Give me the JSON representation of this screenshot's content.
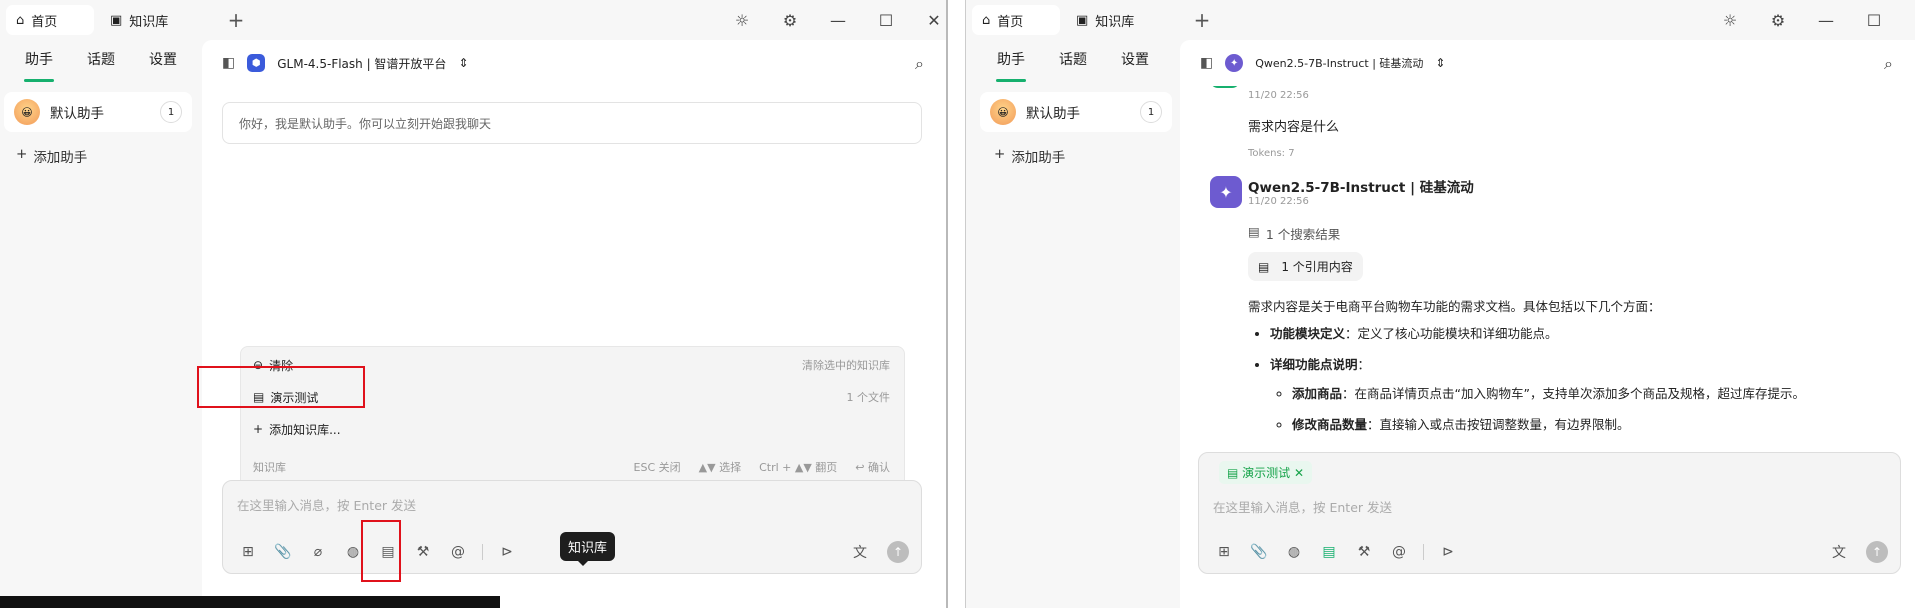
{
  "left": {
    "tabs": {
      "home": "首页",
      "kb": "知识库"
    },
    "sidebar": {
      "tabs": [
        "助手",
        "话题",
        "设置"
      ],
      "assistant": {
        "name": "默认助手",
        "count": "1"
      },
      "add_assistant": "添加助手"
    },
    "model": "GLM-4.5-Flash | 智谱开放平台",
    "greeting": "你好，我是默认助手。你可以立刻开始跟我聊天",
    "kb_popup": {
      "clear_label": "清除",
      "clear_hint": "清除选中的知识库",
      "item_label": "演示测试",
      "item_hint": "1 个文件",
      "add_label": "添加知识库...",
      "footer_title": "知识库",
      "esc": "ESC 关闭",
      "select": "▲▼ 选择",
      "page": "Ctrl + ▲▼ 翻页",
      "confirm": "↩ 确认"
    },
    "input_placeholder": "在这里输入消息，按 Enter 发送",
    "tooltip": "知识库"
  },
  "right": {
    "tabs": {
      "home": "首页",
      "kb": "知识库"
    },
    "sidebar": {
      "tabs": [
        "助手",
        "话题",
        "设置"
      ],
      "assistant": {
        "name": "默认助手",
        "count": "1"
      },
      "add_assistant": "添加助手"
    },
    "model": "Qwen2.5-7B-Instruct | 硅基流动",
    "chat": {
      "user_time": "11/20 22:56",
      "user_text": "需求内容是什么",
      "tokens": "Tokens: 7",
      "bot_name": "Qwen2.5-7B-Instruct | 硅基流动",
      "bot_time": "11/20 22:56",
      "search_results": "1 个搜索结果",
      "quote": "1 个引用内容",
      "intro": "需求内容是关于电商平台购物车功能的需求文档。具体包括以下几个方面：",
      "b1_title": "功能模块定义",
      "b1_text": "：定义了核心功能模块和详细功能点。",
      "b2_title": "详细功能点说明",
      "b2_text": "：",
      "s1_title": "添加商品",
      "s1_text": "：在商品详情页点击“加入购物车”，支持单次添加多个商品及规格，超过库存提示。",
      "s2_title": "修改商品数量",
      "s2_text": "：直接输入或点击按钮调整数量，有边界限制。"
    },
    "chip": "演示测试",
    "input_placeholder": "在这里输入消息，按 Enter 发送"
  },
  "colors": {
    "accent": "#16b06e",
    "red_highlight": "#e0111b"
  }
}
